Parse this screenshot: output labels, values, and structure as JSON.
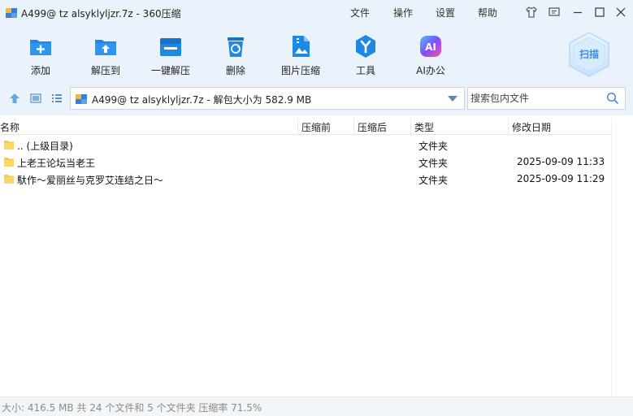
{
  "window": {
    "title": "A499@ tz alsyklyljzr.7z - 360压缩",
    "menus": [
      "文件",
      "操作",
      "设置",
      "帮助"
    ]
  },
  "toolbar": {
    "items": [
      {
        "label": "添加",
        "icon": "add-icon"
      },
      {
        "label": "解压到",
        "icon": "extract-to-icon"
      },
      {
        "label": "一键解压",
        "icon": "one-click-extract-icon"
      },
      {
        "label": "删除",
        "icon": "delete-icon"
      },
      {
        "label": "图片压缩",
        "icon": "image-compress-icon"
      },
      {
        "label": "工具",
        "icon": "tools-icon"
      },
      {
        "label": "AI办公",
        "icon": "ai-office-icon"
      }
    ],
    "scan_label": "扫描"
  },
  "address": {
    "path": "A499@ tz alsyklyljzr.7z - 解包大小为 582.9 MB"
  },
  "search": {
    "placeholder": "搜索包内文件"
  },
  "table": {
    "columns": [
      "名称",
      "压缩前",
      "压缩后",
      "类型",
      "修改日期"
    ],
    "rows": [
      {
        "name": ".. (上级目录)",
        "before": "",
        "after": "",
        "type": "文件夹",
        "date": ""
      },
      {
        "name": "上老王论坛当老王",
        "before": "",
        "after": "",
        "type": "文件夹",
        "date": "2025-09-09 11:33"
      },
      {
        "name": "馱作～爱丽丝与克罗艾连结之日～",
        "before": "",
        "after": "",
        "type": "文件夹",
        "date": "2025-09-09 11:29"
      }
    ]
  },
  "status": {
    "text": "大小: 416.5 MB 共 24 个文件和 5 个文件夹 压缩率 71.5%"
  },
  "colors": {
    "chrome_bg": "#eaf3fc",
    "accent_blue": "#1e88e5",
    "folder_yellow": "#f7c948"
  }
}
